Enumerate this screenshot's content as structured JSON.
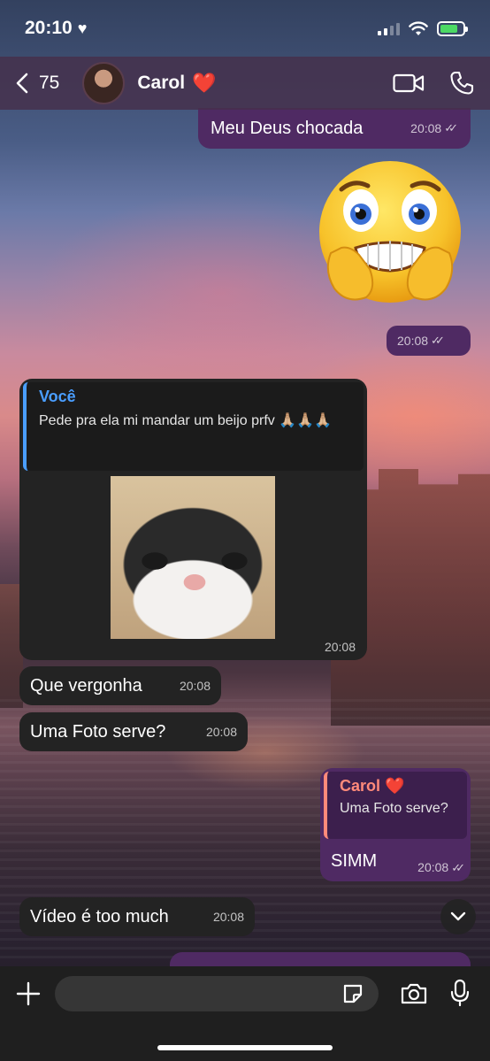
{
  "status_bar": {
    "time": "20:10",
    "heart_glyph": "♥"
  },
  "header": {
    "back_count": "75",
    "contact_name": "Carol",
    "contact_emoji": "❤️"
  },
  "messages": [
    {
      "direction": "out",
      "text": "Meu Deus chocada",
      "time": "20:08",
      "status": "read"
    },
    {
      "direction": "out",
      "type": "sticker",
      "icon": "worried-emoji-sticker",
      "time": "20:08",
      "status": "read"
    },
    {
      "direction": "in",
      "type": "photo-reply",
      "reply_author": "Você",
      "reply_text": "Pede pra ela mi mandar um beijo prfv 🙏🏼🙏🏼🙏🏼",
      "photo_icon": "cat-photo",
      "time": "20:08"
    },
    {
      "direction": "in",
      "text": "Que vergonha",
      "time": "20:08"
    },
    {
      "direction": "in",
      "text": "Uma Foto serve?",
      "time": "20:08"
    },
    {
      "direction": "out",
      "reply_author": "Carol ❤️",
      "reply_text": "Uma Foto serve?",
      "text": "SIMM",
      "time": "20:08",
      "status": "read"
    },
    {
      "direction": "in",
      "text": "Vídeo é too much",
      "time": "20:08"
    }
  ],
  "input": {
    "placeholder": ""
  },
  "colors": {
    "outgoing_bubble": "#4f2a63",
    "incoming_bubble": "#232323",
    "header_bg": "#46304b",
    "reply_accent_you": "#4a9eff",
    "reply_accent_carol": "#ff8a7a",
    "battery": "#4cd964"
  }
}
